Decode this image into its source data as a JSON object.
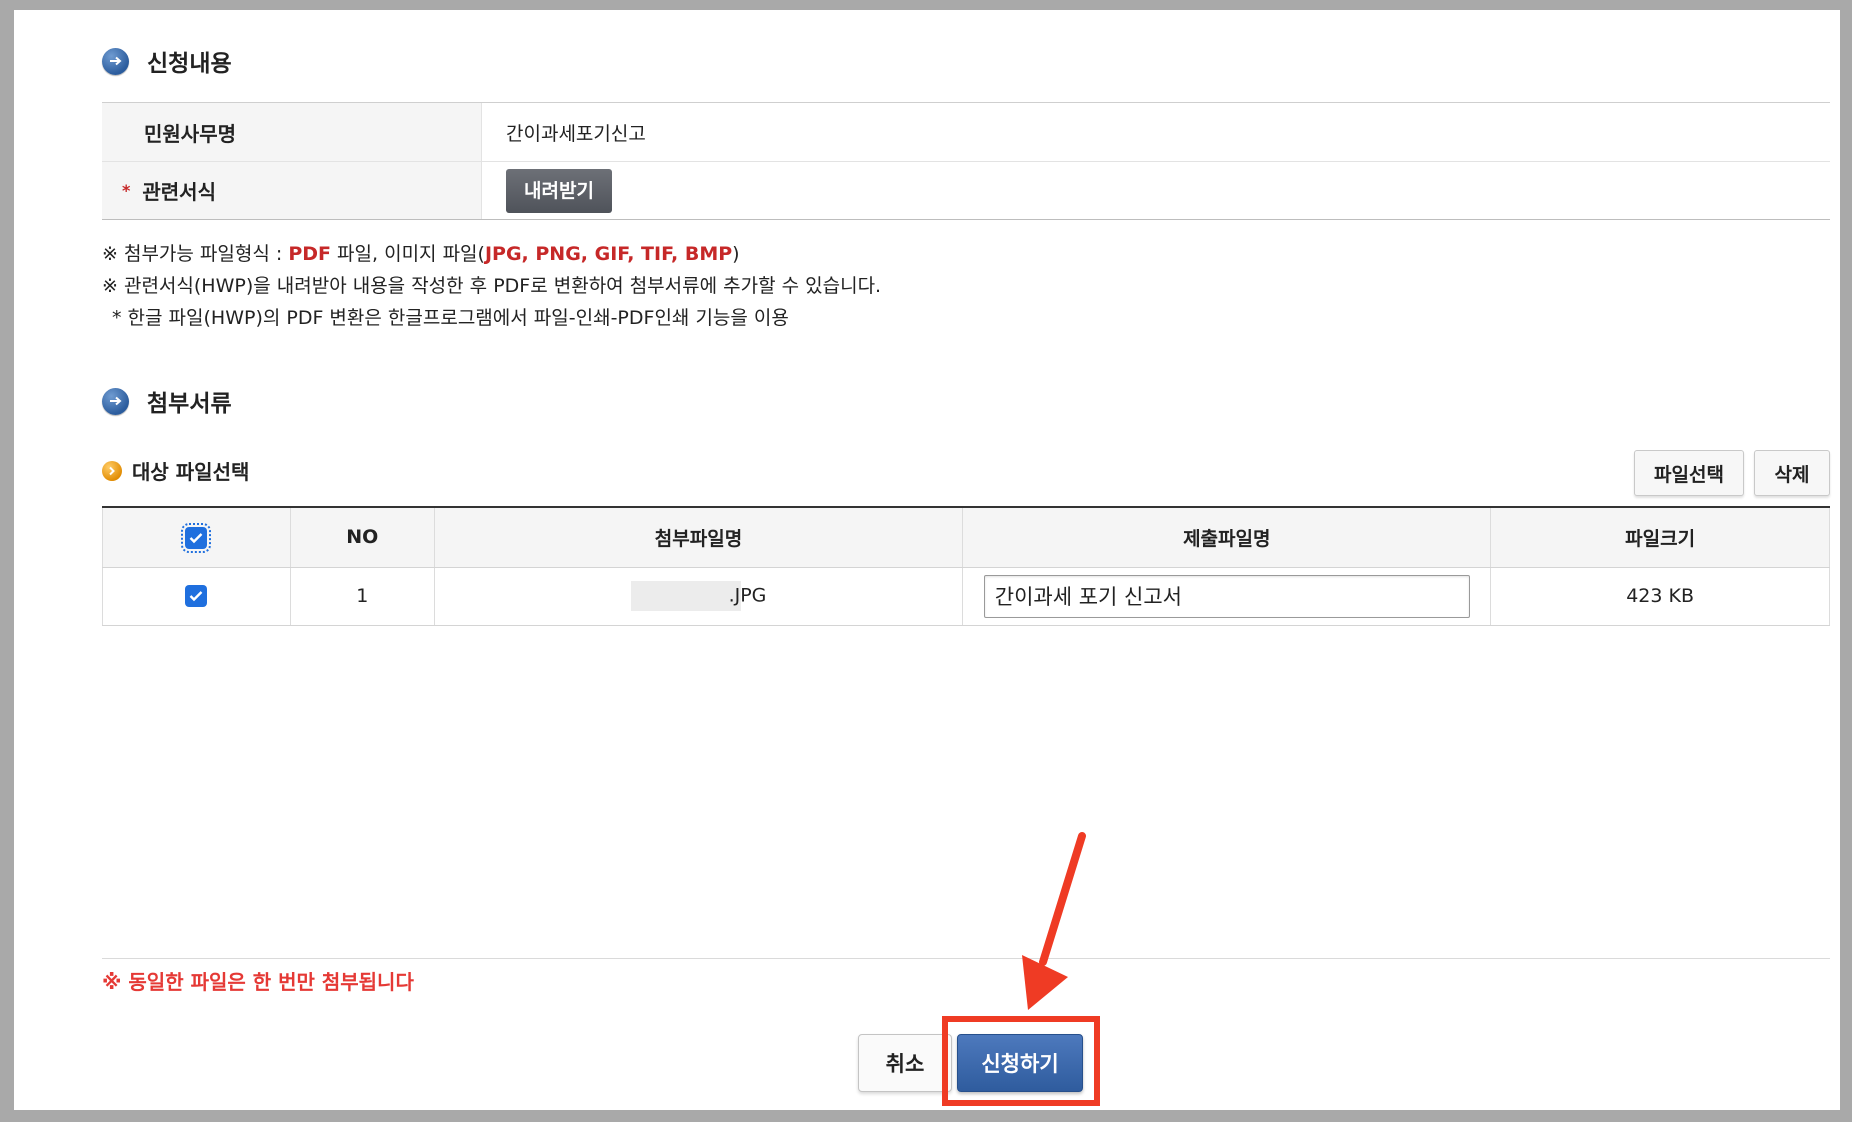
{
  "section1": {
    "title": "신청내용"
  },
  "info": {
    "row1_label": "민원사무명",
    "row1_value": "간이과세포기신고",
    "row2_star": "*",
    "row2_label": "관련서식",
    "download_button": "내려받기"
  },
  "notes": {
    "line1_a": "※ 첨부가능 파일형식 : ",
    "line1_pdf": "PDF",
    "line1_b": " 파일, 이미지 파일(",
    "line1_img": "JPG, PNG, GIF, TIF, BMP",
    "line1_c": ")",
    "line2": "※ 관련서식(HWP)을 내려받아 내용을 작성한 후 PDF로 변환하여 첨부서류에 추가할 수 있습니다.",
    "line3": "* 한글 파일(HWP)의 PDF 변환은 한글프로그램에서 파일-인쇄-PDF인쇄 기능을 이용"
  },
  "section2": {
    "title": "첨부서류"
  },
  "file_select": {
    "title": "대상 파일선택",
    "select_button": "파일선택",
    "delete_button": "삭제"
  },
  "file_table": {
    "headers": [
      "",
      "NO",
      "첨부파일명",
      "제출파일명",
      "파일크기"
    ],
    "rows": [
      {
        "checked": true,
        "no": "1",
        "filename": "JPG",
        "submit_name": "간이과세 포기 신고서",
        "size": "423 KB"
      }
    ]
  },
  "warning": "※ 동일한 파일은 한 번만 첨부됩니다",
  "actions": {
    "cancel": "취소",
    "submit": "신청하기"
  },
  "colors": {
    "accent_red": "#ef3b24",
    "primary_blue": "#2f5c9e",
    "note_red": "#c62828"
  }
}
